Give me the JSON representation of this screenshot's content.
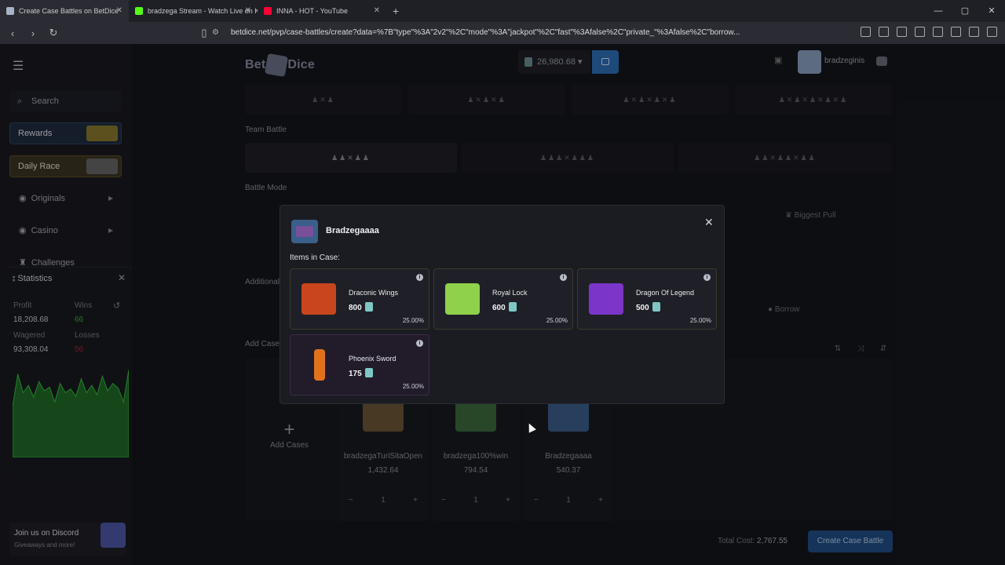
{
  "browser": {
    "tabs": [
      {
        "title": "Create Case Battles on BetDice",
        "color": "#a7b4c7"
      },
      {
        "title": "bradzega Stream - Watch Live on Kic",
        "color": "#53fc18"
      },
      {
        "title": "INNA - HOT - YouTube",
        "color": "#ff0033"
      }
    ],
    "url": "betdice.net/pvp/case-battles/create?data=%7B\"type\"%3A\"2v2\"%2C\"mode\"%3A\"jackpot\"%2C\"fast\"%3Afalse%2C\"private_\"%3Afalse%2C\"borrow..."
  },
  "header": {
    "logo_left": "Bet",
    "logo_right": "Dice",
    "balance": "26,980.68",
    "username": "bradzeginis"
  },
  "sidebar": {
    "search": "Search",
    "rewards": "Rewards",
    "daily_race": "Daily Race",
    "originals": "Originals",
    "casino": "Casino",
    "challenges": "Challenges"
  },
  "statistics": {
    "title": "Statistics",
    "profit_label": "Profit",
    "profit": "18,208.68",
    "wins_label": "Wins",
    "wins": "66",
    "wagered_label": "Wagered",
    "wagered": "93,308.04",
    "losses_label": "Losses",
    "losses": "56",
    "chart_data": {
      "type": "area",
      "values": [
        0.55,
        0.9,
        0.7,
        0.78,
        0.65,
        0.82,
        0.72,
        0.76,
        0.6,
        0.8,
        0.7,
        0.74,
        0.66,
        0.85,
        0.7,
        0.78,
        0.68,
        0.88,
        0.72,
        0.8,
        0.75,
        0.6,
        0.95
      ]
    }
  },
  "discord": {
    "title": "Join us on Discord",
    "subtitle": "Giveaways and more!"
  },
  "content": {
    "team_battle": "Team Battle",
    "battle_mode": "Battle Mode",
    "additional": "Additional",
    "add_cases_title": "Add Cases",
    "biggest_pull": "Biggest Pull",
    "borrow": "Borrow",
    "add_cases_btn": "Add Cases",
    "cases": [
      {
        "name": "bradzegaTuriSitaOpen",
        "price": "1,432.64",
        "qty": "1",
        "color": "#6b5534"
      },
      {
        "name": "bradzega100%win",
        "price": "794.54",
        "qty": "1",
        "color": "#3a6a3a"
      },
      {
        "name": "Bradzegaaaa",
        "price": "540.37",
        "qty": "1",
        "color": "#3a5f8a"
      }
    ],
    "total_label": "Total Cost:",
    "total": "2,767.55",
    "create_btn": "Create Case Battle"
  },
  "modal": {
    "title": "Bradzegaaaa",
    "items_label": "Items in Case:",
    "items": [
      {
        "name": "Draconic Wings",
        "value": "800",
        "pct": "25.00%",
        "color": "#c9451e"
      },
      {
        "name": "Royal Lock",
        "value": "600",
        "pct": "25.00%",
        "color": "#8fd14a"
      },
      {
        "name": "Dragon Of Legend",
        "value": "500",
        "pct": "25.00%",
        "color": "#7b36c9"
      },
      {
        "name": "Phoenix Sword",
        "value": "175",
        "pct": "25.00%",
        "color": "#e0721c"
      }
    ]
  }
}
